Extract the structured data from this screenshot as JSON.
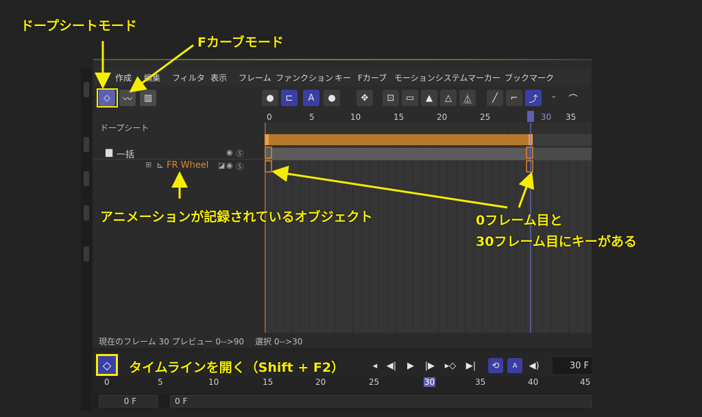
{
  "menu": {
    "hamburger": "≡",
    "items": [
      "作成",
      "編集",
      "フィルタ",
      "表示",
      "フレーム",
      "ファンクション",
      "キー",
      "Fカーブ",
      "モーションシステム",
      "マーカー",
      "ブックマーク"
    ]
  },
  "left_panel": {
    "section_label": "ドープシート",
    "rows": [
      {
        "name": "一括"
      },
      {
        "name": "FR Wheel"
      }
    ],
    "solo_glyph": "Ⓢ"
  },
  "ruler": {
    "ticks": [
      "0",
      "5",
      "10",
      "15",
      "20",
      "25",
      "30",
      "35"
    ]
  },
  "status": {
    "current_frame": "現在のフレーム  30  プレビュー  0-->90",
    "selection": "選択  0-->30"
  },
  "bottom": {
    "frame_field": "30 F",
    "ruler_ticks": [
      "0",
      "5",
      "10",
      "15",
      "20",
      "25",
      "30",
      "35",
      "40",
      "45"
    ],
    "start_field": "0 F",
    "end_field": "0 F"
  },
  "annotations": {
    "dopesheet_mode": "ドープシートモード",
    "fcurve_mode": "Fカーブモード",
    "animated_object": "アニメーションが記録されているオブジェクト",
    "keys_line1": "0フレーム目と",
    "keys_line2": "30フレーム目にキーがある",
    "open_timeline": "タイムラインを開く（Shift + F2）"
  },
  "colors": {
    "accent": "#f6ee00",
    "key_orange": "#e0872a",
    "active_blue": "#5d5fb0"
  }
}
